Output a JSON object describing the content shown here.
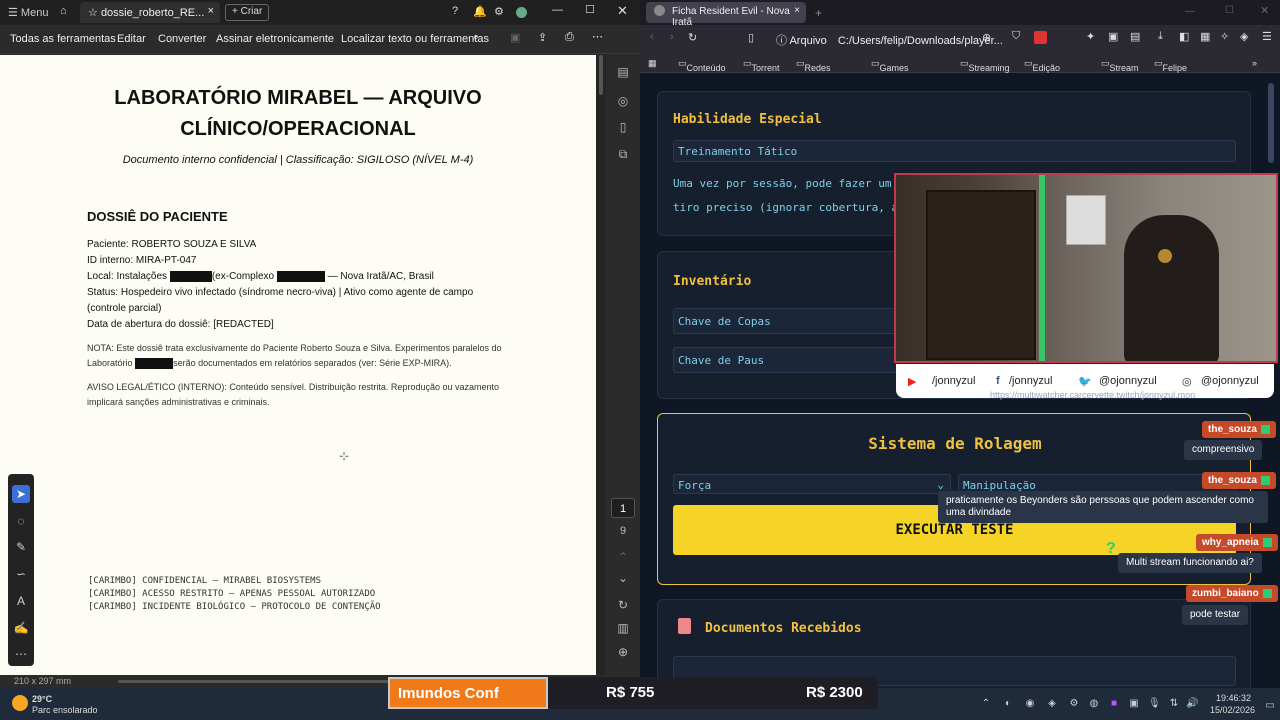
{
  "pdf": {
    "titlebar": {
      "menu": "Menu",
      "tab_title": "dossie_roberto_RE...",
      "new_button": "Criar"
    },
    "toolbar": {
      "all_tools": "Todas as ferramentas",
      "edit": "Editar",
      "convert": "Converter",
      "sign": "Assinar eletronicamente",
      "search": "Localizar texto ou ferramentas"
    },
    "document": {
      "title_line1": "LABORATÓRIO MIRABEL — ARQUIVO",
      "title_line2": "CLÍNICO/OPERACIONAL",
      "subtitle": "Documento interno confidencial | Classificação: SIGILOSO (NÍVEL M-4)",
      "section_title": "DOSSIÊ DO PACIENTE",
      "patient": "Paciente: ROBERTO SOUZA E SILVA",
      "internal_id": "ID interno: MIRA-PT-047",
      "local_prefix": "Local: Instalações",
      "local_middle": "(ex-Complexo",
      "local_suffix": "— Nova Iratã/AC, Brasil",
      "status_line1": "Status: Hospedeiro vivo infectado (síndrome necro-viva) | Ativo como agente de campo",
      "status_line2": "(controle parcial)",
      "opening_date": "Data de abertura do dossiê: [REDACTED]",
      "note_line1": "NOTA: Este dossiê trata exclusivamente do Paciente Roberto Souza e Silva. Experimentos paralelos do",
      "note_line2_prefix": "Laboratório",
      "note_line2_suffix": "serão documentados em relatórios separados (ver: Série EXP-MIRA).",
      "legal_line1": "AVISO LEGAL/ÉTICO (INTERNO): Conteúdo sensível. Distribuição restrita. Reprodução ou vazamento",
      "legal_line2": "implicará sanções administrativas e criminais.",
      "stamps": [
        "[CARIMBO] CONFIDENCIAL — MIRABEL BIOSYSTEMS",
        "[CARIMBO] ACESSO RESTRITO — APENAS PESSOAL AUTORIZADO",
        "[CARIMBO] INCIDENTE BIOLÓGICO — PROTOCOLO DE CONTENÇÃO"
      ]
    },
    "page_current": "1",
    "page_total": "9",
    "page_size": "210 x 297 mm"
  },
  "browser": {
    "tab_title": "Ficha Resident Evil - Nova Iratã",
    "address_label": "Arquivo",
    "address": "C:/Users/felip/Downloads/player...",
    "bookmarks": [
      "Conteúdo",
      "Torrent",
      "Redes sociais",
      "Games e Notícias",
      "Streaming",
      "Edição Online",
      "Stream",
      "Felipe"
    ],
    "ability": {
      "heading": "Habilidade Especial",
      "name": "Treinamento Tático",
      "desc_line1": "Uma vez por sessão, pode fazer um tes",
      "desc_line2": "tiro preciso (ignorar cobertura, acer"
    },
    "inventory": {
      "heading": "Inventário",
      "items": [
        "Chave de Copas",
        "Chave de Paus"
      ]
    },
    "rolling": {
      "heading": "Sistema de Rolagem",
      "attr1": "Força",
      "attr2": "Manipulação",
      "execute": "EXECUTAR TESTE"
    },
    "documents": {
      "heading": "Documentos Recebidos"
    },
    "partial_url": "https://multiwatcher.carcervette.twitch/jonnyzul.mon"
  },
  "webcam": {
    "socials": [
      "/jonnyzul",
      "/jonnyzul",
      "@ojonnyzul",
      "@ojonnyzul"
    ]
  },
  "chat": [
    {
      "user": "the_souza",
      "message": "compreensivo"
    },
    {
      "user": "the_souza",
      "message": "praticamente os Beyonders são perssoas que podem ascender como uma divindade"
    },
    {
      "user": "why_apneia",
      "message": "Multi stream funcionando ai?"
    },
    {
      "user": "zumbi_baiano",
      "message": "pode testar"
    }
  ],
  "overlay": {
    "sponsor": "Imundos Conf",
    "price1": "R$ 755",
    "price2": "R$ 2300"
  },
  "taskbar": {
    "temp": "29°C",
    "weather": "Parc ensolarado",
    "time": "19:46:32",
    "date": "15/02/2026"
  },
  "colors": {
    "accent_gold": "#f0c040",
    "execute_yellow": "#f5d327",
    "overlay_orange": "#f07a1a",
    "chat_user": "#c44a2a"
  }
}
